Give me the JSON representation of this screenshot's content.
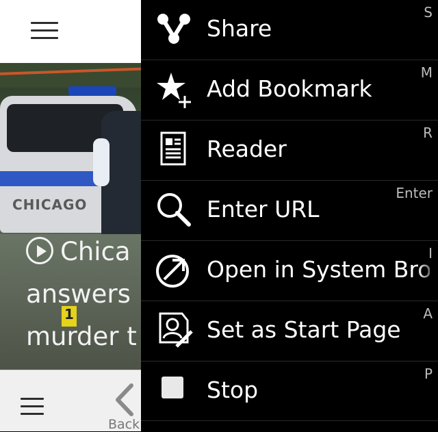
{
  "browser": {
    "hero_caption": [
      "Chica",
      "answers",
      "murder t"
    ],
    "evidence_marker": "1",
    "back_label": "Back",
    "hero_sign_text": "CHICAGO"
  },
  "menu": {
    "items": [
      {
        "label": "Share",
        "shortcut": "S",
        "icon": "share-icon"
      },
      {
        "label": "Add Bookmark",
        "shortcut": "M",
        "icon": "add-bookmark-icon"
      },
      {
        "label": "Reader",
        "shortcut": "R",
        "icon": "reader-icon"
      },
      {
        "label": "Enter URL",
        "shortcut": "Enter",
        "icon": "search-icon"
      },
      {
        "label": "Open in System Browser",
        "shortcut": "I",
        "icon": "open-external-icon"
      },
      {
        "label": "Set as Start Page",
        "shortcut": "A",
        "icon": "set-start-page-icon"
      },
      {
        "label": "Stop",
        "shortcut": "P",
        "icon": "stop-icon"
      }
    ]
  },
  "colors": {
    "menu_background": "#000000",
    "menu_text": "#ffffff",
    "shortcut_text": "#bdbdbd"
  }
}
